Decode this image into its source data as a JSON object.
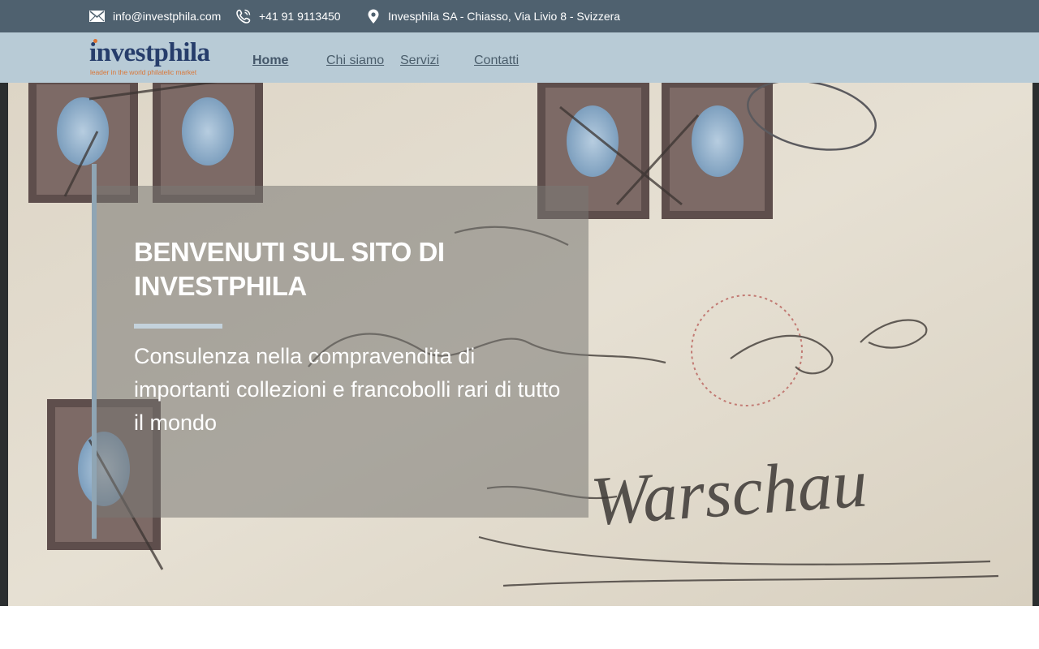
{
  "topbar": {
    "email": "info@investphila.com",
    "phone": "+41 91 9113450",
    "address": "Invesphila SA - Chiasso, Via Livio 8 - Svizzera",
    "icons": [
      "mail-icon",
      "phone-icon",
      "location-pin-icon"
    ]
  },
  "brand": {
    "name": "investphila",
    "tagline": "leader in the world philatelic market"
  },
  "nav": {
    "items": [
      {
        "label": "Home"
      },
      {
        "label": "Chi siamo"
      },
      {
        "label": "Servizi"
      },
      {
        "label": "Contatti"
      }
    ]
  },
  "hero": {
    "title": "BENVENUTI SUL SITO DI INVESTPHILA",
    "subtitle": "Consulenza nella compravendita di importanti collezioni e francobolli rari di tutto il mondo",
    "background_handwriting": "Warschau"
  },
  "colors": {
    "topbar": "#4f616f",
    "navbar": "#b8cbd6",
    "brand_blue": "#263d6b",
    "brand_orange": "#d9783a",
    "accent_bar": "#8fa5b4"
  }
}
